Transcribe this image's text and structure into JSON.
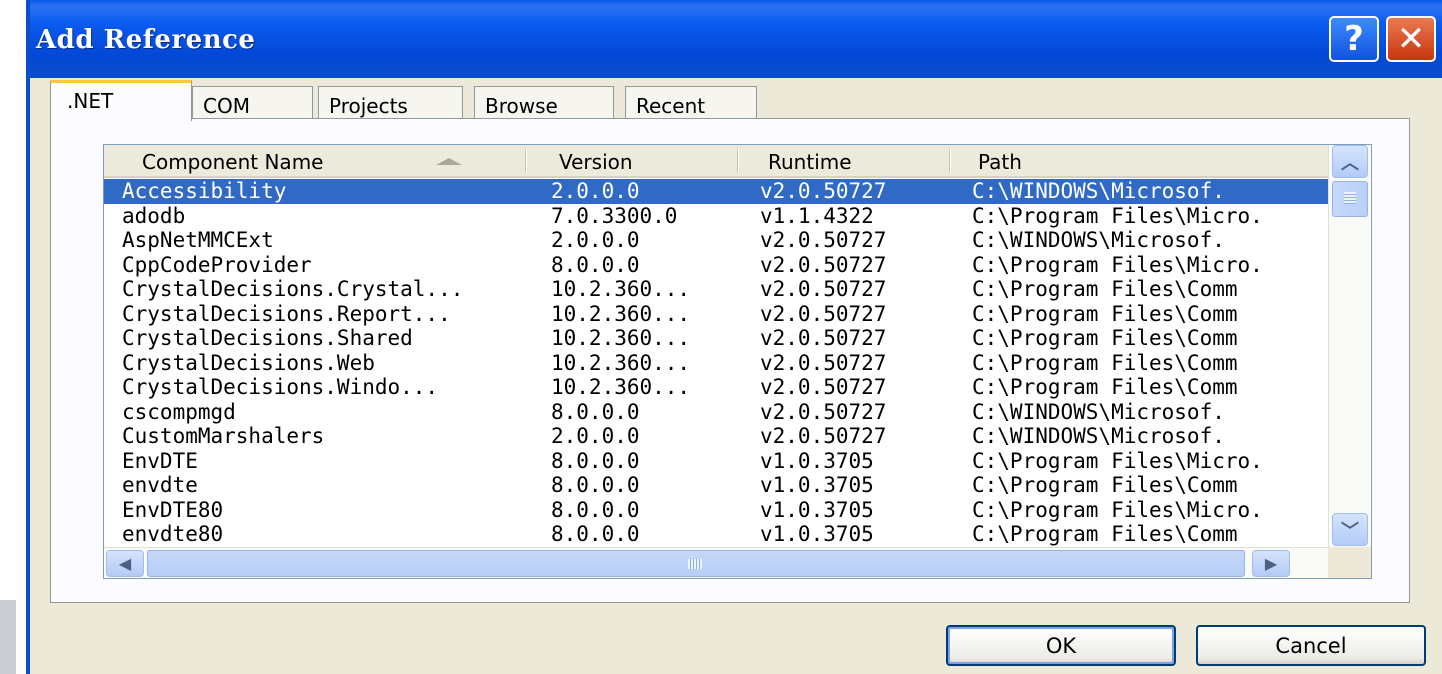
{
  "window": {
    "title": "Add Reference",
    "help_glyph": "?",
    "close_glyph": "✕"
  },
  "tabs": [
    {
      "label": ".NET",
      "active": true
    },
    {
      "label": "COM",
      "active": false
    },
    {
      "label": "Projects",
      "active": false
    },
    {
      "label": "Browse",
      "active": false
    },
    {
      "label": "Recent",
      "active": false
    }
  ],
  "list": {
    "columns": {
      "name": "Component Name",
      "version": "Version",
      "runtime": "Runtime",
      "path": "Path"
    },
    "sort_column": "name",
    "sort_direction": "ascending",
    "selected_index": 0,
    "rows": [
      {
        "name": "Accessibility",
        "version": "2.0.0.0",
        "runtime": "v2.0.50727",
        "path": "C:\\WINDOWS\\Microsof."
      },
      {
        "name": "adodb",
        "version": "7.0.3300.0",
        "runtime": "v1.1.4322",
        "path": "C:\\Program Files\\Micro."
      },
      {
        "name": "AspNetMMCExt",
        "version": "2.0.0.0",
        "runtime": "v2.0.50727",
        "path": "C:\\WINDOWS\\Microsof."
      },
      {
        "name": "CppCodeProvider",
        "version": "8.0.0.0",
        "runtime": "v2.0.50727",
        "path": "C:\\Program Files\\Micro."
      },
      {
        "name": "CrystalDecisions.Crystal...",
        "version": "10.2.360...",
        "runtime": "v2.0.50727",
        "path": "C:\\Program Files\\Comm"
      },
      {
        "name": "CrystalDecisions.Report...",
        "version": "10.2.360...",
        "runtime": "v2.0.50727",
        "path": "C:\\Program Files\\Comm"
      },
      {
        "name": "CrystalDecisions.Shared",
        "version": "10.2.360...",
        "runtime": "v2.0.50727",
        "path": "C:\\Program Files\\Comm"
      },
      {
        "name": "CrystalDecisions.Web",
        "version": "10.2.360...",
        "runtime": "v2.0.50727",
        "path": "C:\\Program Files\\Comm"
      },
      {
        "name": "CrystalDecisions.Windo...",
        "version": "10.2.360...",
        "runtime": "v2.0.50727",
        "path": "C:\\Program Files\\Comm"
      },
      {
        "name": "cscompmgd",
        "version": "8.0.0.0",
        "runtime": "v2.0.50727",
        "path": "C:\\WINDOWS\\Microsof."
      },
      {
        "name": "CustomMarshalers",
        "version": "2.0.0.0",
        "runtime": "v2.0.50727",
        "path": "C:\\WINDOWS\\Microsof."
      },
      {
        "name": "EnvDTE",
        "version": "8.0.0.0",
        "runtime": "v1.0.3705",
        "path": "C:\\Program Files\\Micro."
      },
      {
        "name": "envdte",
        "version": "8.0.0.0",
        "runtime": "v1.0.3705",
        "path": "C:\\Program Files\\Comm"
      },
      {
        "name": "EnvDTE80",
        "version": "8.0.0.0",
        "runtime": "v1.0.3705",
        "path": "C:\\Program Files\\Micro."
      },
      {
        "name": "envdte80",
        "version": "8.0.0.0",
        "runtime": "v1.0.3705",
        "path": "C:\\Program Files\\Comm"
      }
    ]
  },
  "scrollbars": {
    "up_glyph": "︿",
    "down_glyph": "﹀",
    "left_glyph": "◀",
    "right_glyph": "▶"
  },
  "buttons": {
    "ok": "OK",
    "cancel": "Cancel"
  },
  "colors": {
    "titlebar": "#0a5bf0",
    "selection": "#316ac5",
    "dialog_bg": "#ece9d8",
    "active_tab_accent": "#ffc83c"
  },
  "icons": {
    "help": "question-mark-icon",
    "close": "close-x-icon",
    "sort": "sort-ascending-icon"
  }
}
